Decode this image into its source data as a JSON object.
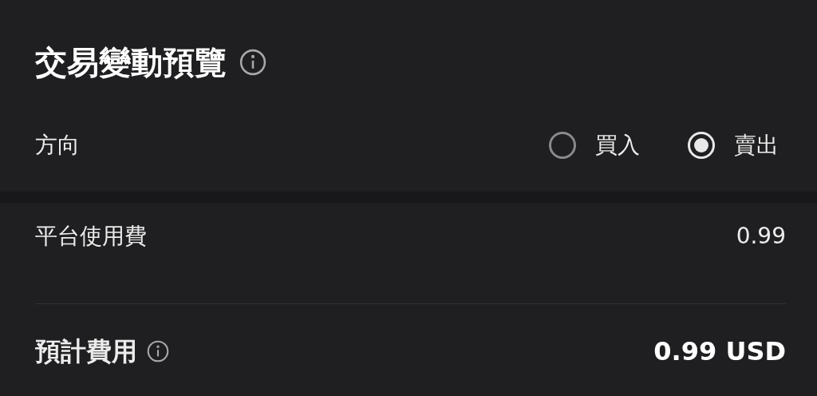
{
  "title": "交易變動預覽",
  "direction": {
    "label": "方向",
    "options": [
      {
        "label": "買入",
        "selected": false
      },
      {
        "label": "賣出",
        "selected": true
      }
    ]
  },
  "fee": {
    "label": "平台使用費",
    "value": "0.99"
  },
  "total": {
    "label": "預計費用",
    "value": "0.99 USD"
  }
}
